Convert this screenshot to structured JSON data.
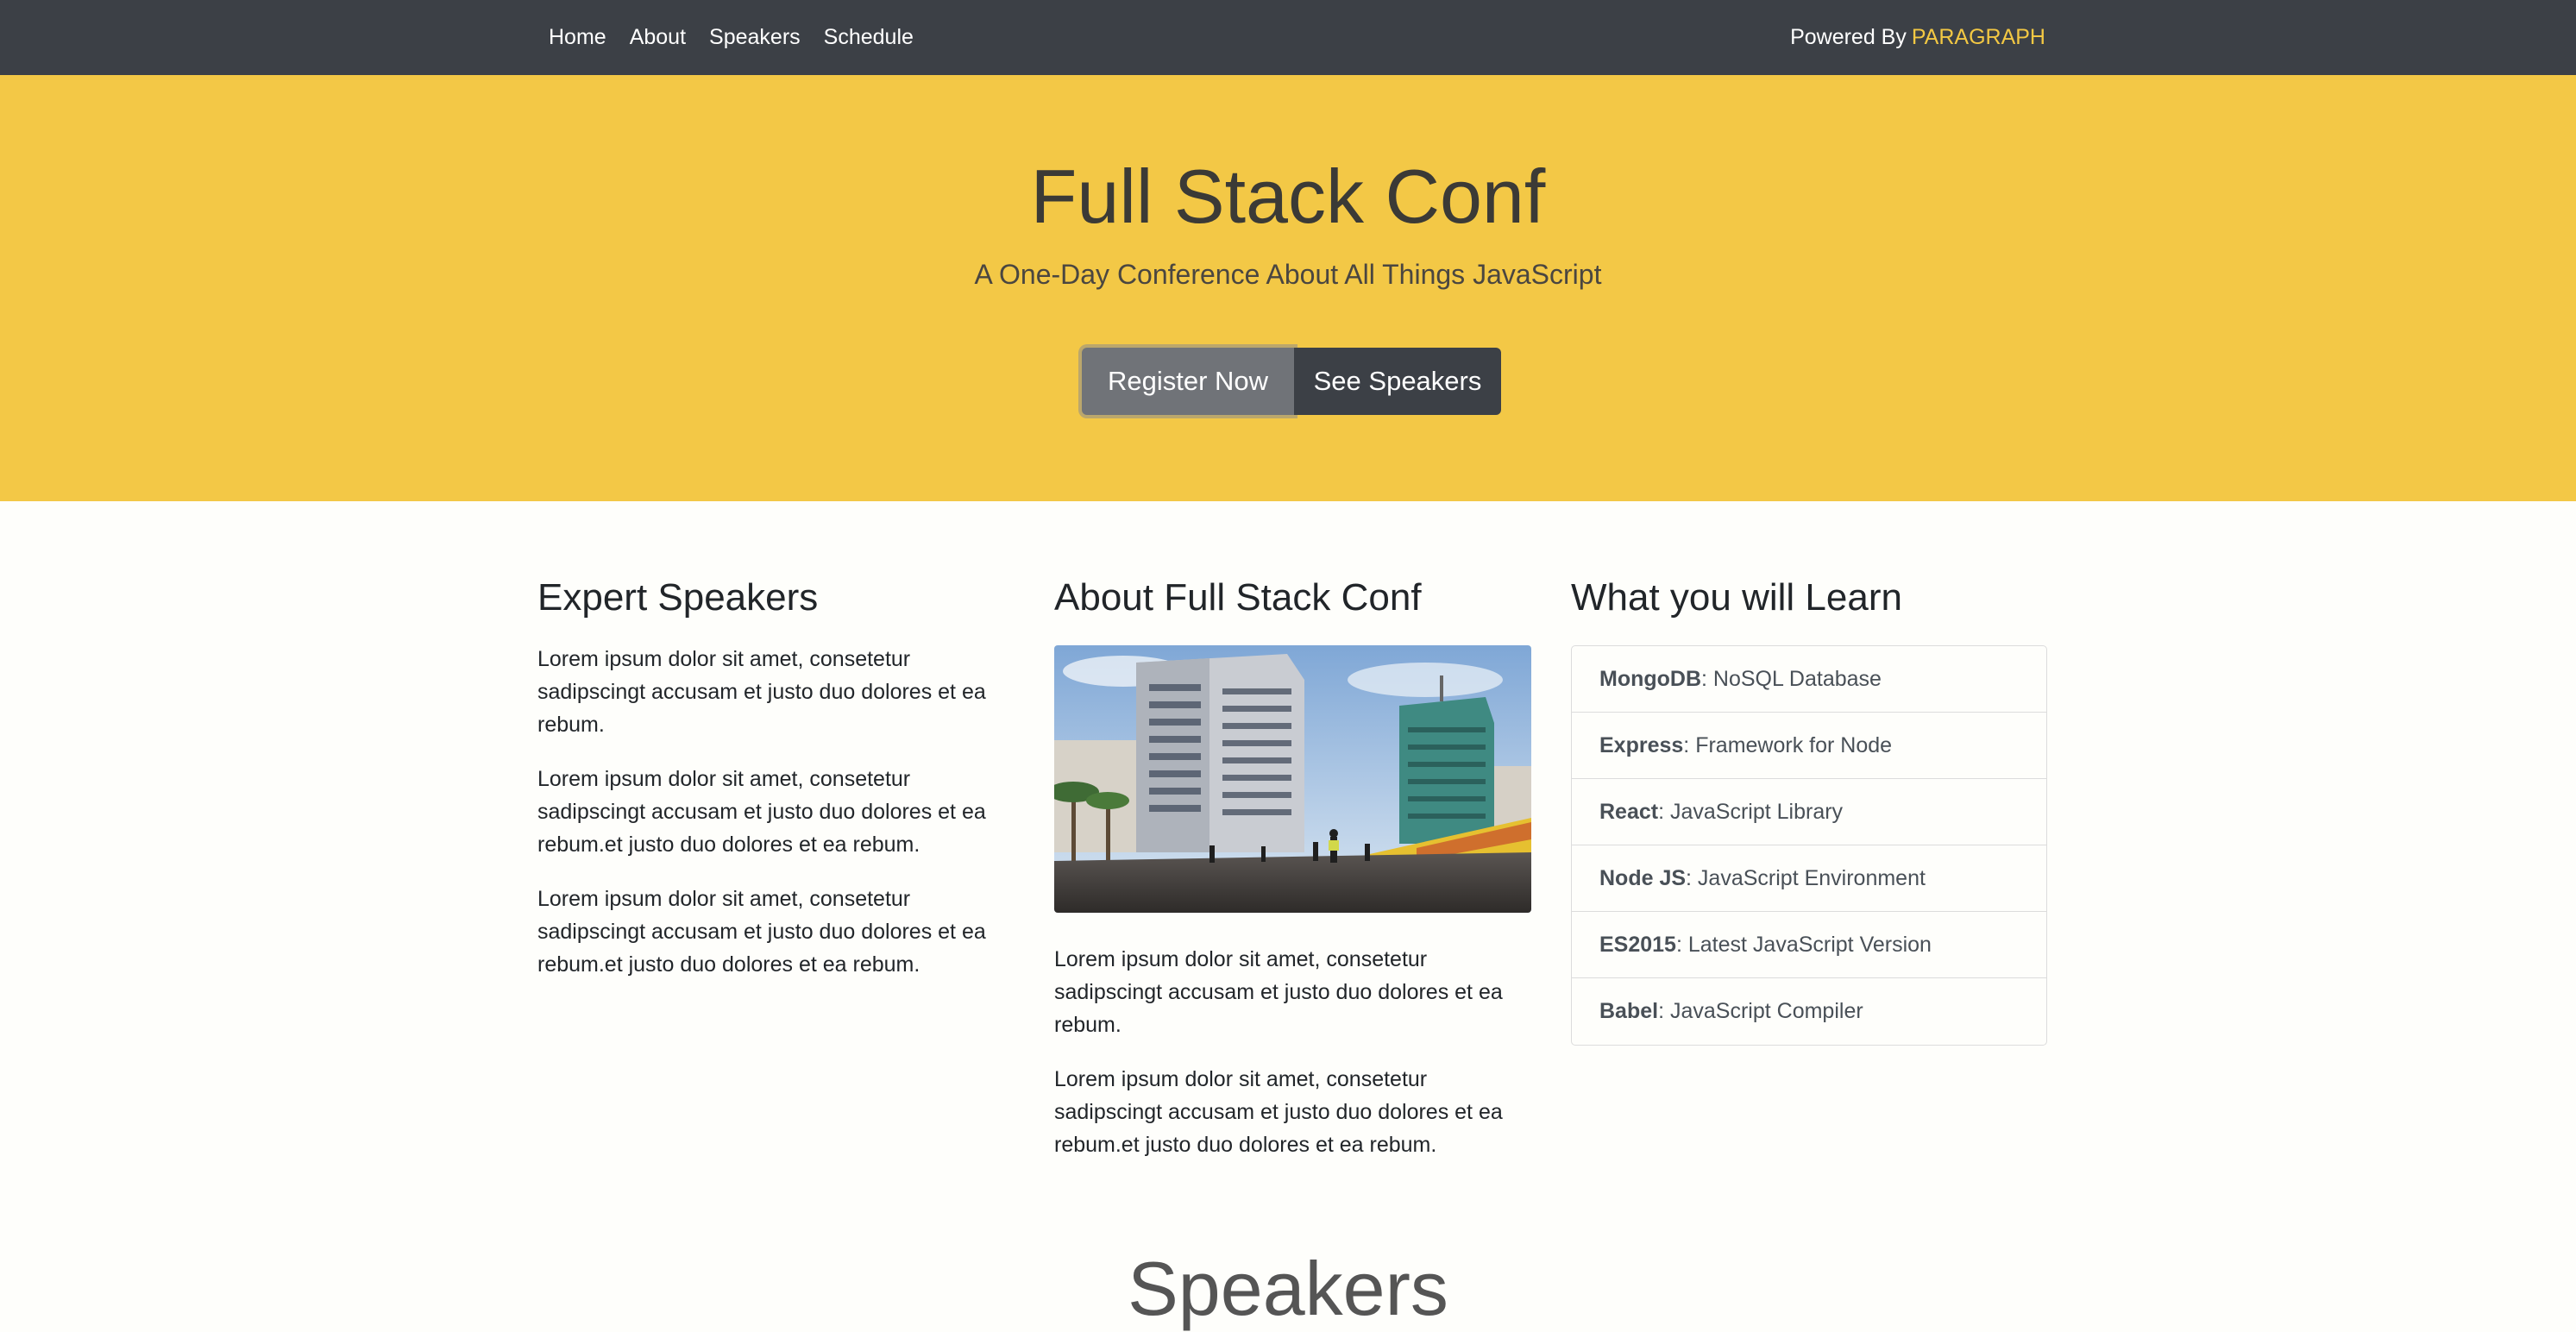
{
  "nav": {
    "items": [
      {
        "label": "Home"
      },
      {
        "label": "About"
      },
      {
        "label": "Speakers"
      },
      {
        "label": "Schedule"
      }
    ],
    "powered_prefix": "Powered By",
    "powered_brand": "PARAGRAPH"
  },
  "hero": {
    "title": "Full Stack Conf",
    "subtitle": "A One-Day Conference About All Things JavaScript",
    "register_label": "Register Now",
    "speakers_label": "See Speakers"
  },
  "expert": {
    "heading": "Expert Speakers",
    "paragraphs": [
      "Lorem ipsum dolor sit amet, consetetur sadipscingt accusam et justo duo dolores et ea rebum.",
      "Lorem ipsum dolor sit amet, consetetur sadipscingt accusam et justo duo dolores et ea rebum.et justo duo dolores et ea rebum.",
      "Lorem ipsum dolor sit amet, consetetur sadipscingt accusam et justo duo dolores et ea rebum.et justo duo dolores et ea rebum."
    ]
  },
  "about": {
    "heading": "About Full Stack Conf",
    "image_icon": "city-street-photo",
    "paragraphs": [
      "Lorem ipsum dolor sit amet, consetetur sadipscingt accusam et justo duo dolores et ea rebum.",
      "Lorem ipsum dolor sit amet, consetetur sadipscingt accusam et justo duo dolores et ea rebum.et justo duo dolores et ea rebum."
    ]
  },
  "learn": {
    "heading": "What you will Learn",
    "items": [
      {
        "name": "MongoDB",
        "desc": ": NoSQL Database"
      },
      {
        "name": "Express",
        "desc": ": Framework for Node"
      },
      {
        "name": "React",
        "desc": ": JavaScript Library"
      },
      {
        "name": "Node JS",
        "desc": ": JavaScript Environment"
      },
      {
        "name": "ES2015",
        "desc": ": Latest JavaScript Version"
      },
      {
        "name": "Babel",
        "desc": ": JavaScript Compiler"
      }
    ]
  },
  "speakers_section": {
    "title": "Speakers"
  },
  "colors": {
    "navbar": "#3c4046",
    "hero": "#f3c846",
    "brand": "#f3c843"
  }
}
